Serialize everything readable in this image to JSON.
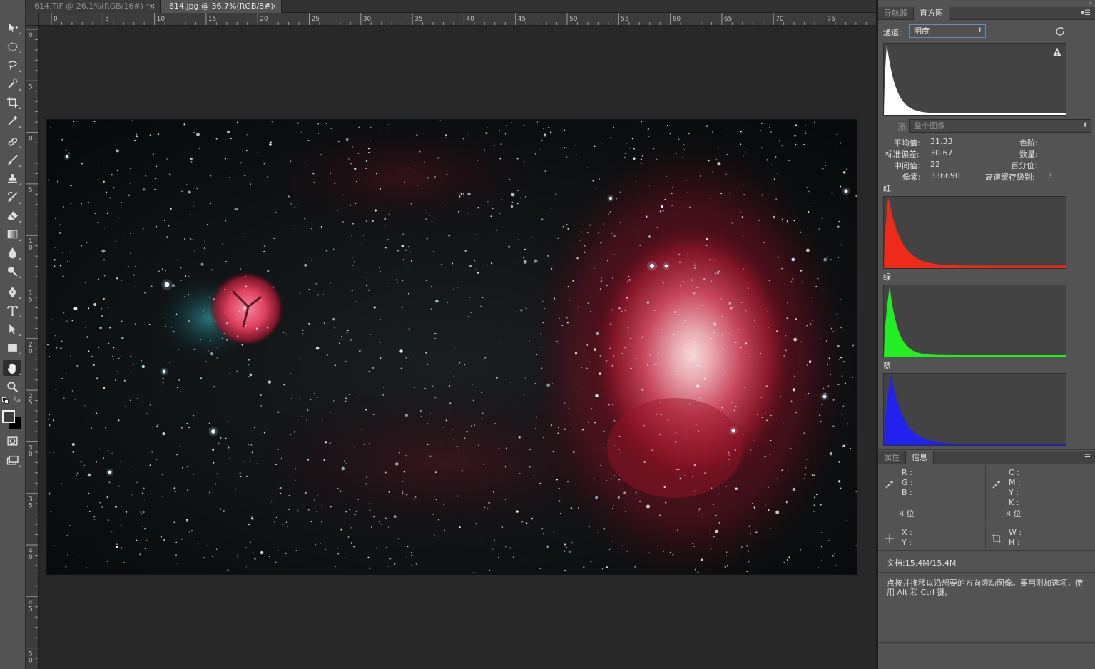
{
  "tabs": [
    {
      "title": "614.TIF @ 26.1%(RGB/16#) *",
      "close": "×",
      "active": false
    },
    {
      "title": "614.jpg @ 36.7%(RGB/8#)",
      "close": "×",
      "active": true
    }
  ],
  "ruler": {
    "h_labels": [
      "0",
      "5",
      "10",
      "15",
      "20",
      "25",
      "30",
      "35",
      "40",
      "45",
      "50",
      "55",
      "60",
      "65",
      "70",
      "75"
    ],
    "v_labels": [
      "0",
      "5",
      "0",
      "5",
      "10",
      "15",
      "20",
      "25",
      "30",
      "35",
      "40",
      "45",
      "50"
    ]
  },
  "tools": [
    {
      "name": "move-tool-icon"
    },
    {
      "name": "ellipse-marquee-tool-icon"
    },
    {
      "name": "lasso-tool-icon"
    },
    {
      "name": "quick-select-tool-icon"
    },
    {
      "name": "crop-tool-icon"
    },
    {
      "name": "eyedropper-tool-icon"
    },
    {
      "name": "healing-brush-tool-icon"
    },
    {
      "name": "brush-tool-icon"
    },
    {
      "name": "clone-stamp-tool-icon"
    },
    {
      "name": "history-brush-tool-icon"
    },
    {
      "name": "eraser-tool-icon"
    },
    {
      "name": "gradient-tool-icon"
    },
    {
      "name": "blur-tool-icon"
    },
    {
      "name": "dodge-tool-icon"
    },
    {
      "name": "pen-tool-icon"
    },
    {
      "name": "type-tool-icon"
    },
    {
      "name": "path-select-tool-icon"
    },
    {
      "name": "rectangle-tool-icon"
    },
    {
      "name": "hand-tool-icon",
      "active": true
    },
    {
      "name": "zoom-tool-icon"
    }
  ],
  "panels": {
    "top_tabs": {
      "navigator": "导航器",
      "histogram": "直方图"
    },
    "histogram": {
      "channel_label": "通道:",
      "channel_value": "明度",
      "source_label": "源:",
      "source_value": "整个图像",
      "stats": {
        "mean_label": "平均值:",
        "mean": "31.33",
        "stddev_label": "标准偏差:",
        "stddev": "30.67",
        "median_label": "中间值:",
        "median": "22",
        "pixels_label": "像素:",
        "pixels": "336690",
        "level_label": "色阶:",
        "count_label": "数量:",
        "percentile_label": "百分位:",
        "cache_label": "高速缓存级别:",
        "cache": "3"
      },
      "red_label": "红",
      "green_label": "绿",
      "blue_label": "蓝",
      "colors": {
        "luminosity": "#ffffff",
        "red": "#ee2a18",
        "green": "#22ee22",
        "blue": "#2222ee"
      }
    },
    "bottom_tabs": {
      "properties": "属性",
      "info": "信息"
    },
    "info": {
      "r": "R :",
      "g": "G :",
      "b": "B :",
      "bits_left": "8 位",
      "c": "C :",
      "m": "M :",
      "y": "Y :",
      "k": "K :",
      "bits_right": "8 位",
      "x": "X :",
      "yy": "Y :",
      "w": "W :",
      "h": "H :",
      "doc": "文档:15.4M/15.4M",
      "hint": "点按并拖移以沿想要的方向滚动图像。要用附加选项，使用 Alt 和 Ctrl 键。"
    }
  }
}
